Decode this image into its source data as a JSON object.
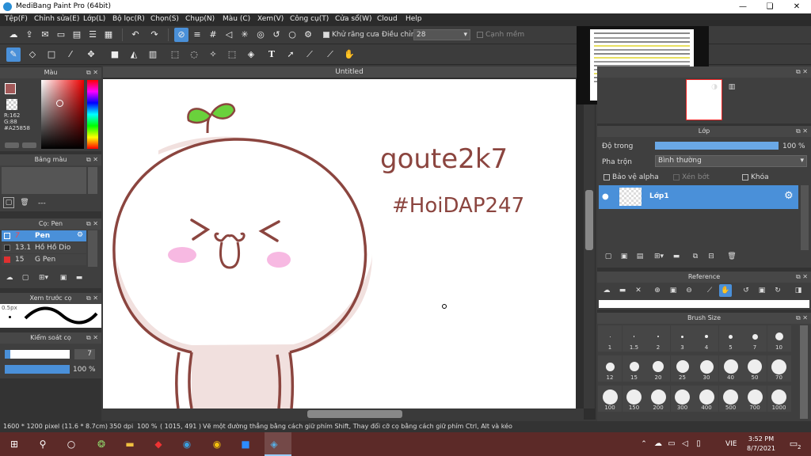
{
  "window": {
    "title": "MediBang Paint Pro (64bit)"
  },
  "menu": [
    "Tệp(F)",
    "Chỉnh sửa(E)",
    "Lớp(L)",
    "Bộ lọc(R)",
    "Chọn(S)",
    "Chụp(N)",
    "Màu (C)",
    "Xem(V)",
    "Công cụ(T)",
    "Cửa sổ(W)",
    "Cloud",
    "Help"
  ],
  "toolbar": {
    "antialias_label": "Khử răng cưa",
    "adjust_label": "Điều chỉnh",
    "adjust_value": "28",
    "edge_label": "Cạnh mềm"
  },
  "canvas": {
    "tab_title": "Untitled",
    "drawing_text_1": "goute2k7",
    "drawing_text_2": "#HoiDAP247"
  },
  "color_panel": {
    "title": "Màu",
    "r": "R:162",
    "g": "G:88",
    "b": "B:88",
    "hex": "#A25858",
    "primary": "#A25858"
  },
  "palette_panel": {
    "title": "Bảng màu",
    "dash": "---"
  },
  "brush_panel": {
    "title": "Cọ: Pen",
    "items": [
      {
        "size": "7",
        "name": "Pen",
        "selected": true,
        "color": "#A25858"
      },
      {
        "size": "13.1",
        "name": "Hồ Hồ Dio",
        "selected": false,
        "color": "#222222"
      },
      {
        "size": "15",
        "name": "G Pen",
        "selected": false,
        "color": "#e03030"
      }
    ]
  },
  "preview_panel": {
    "title": "Xem trước cọ",
    "size": "0.5px"
  },
  "control_panel": {
    "title": "Kiểm soát cọ",
    "size": "7",
    "opacity": "100 %",
    "opacity_frac": 1.0
  },
  "layer_panel": {
    "title": "Lớp",
    "opacity_label": "Độ trong",
    "opacity_value": "100 %",
    "opacity_frac": 1.0,
    "blend_label": "Pha trộn",
    "blend_value": "Bình thường",
    "protect_alpha": "Bảo vệ alpha",
    "clip": "Xén bớt",
    "lock": "Khóa",
    "layer_name": "Lớp1"
  },
  "reference_panel": {
    "title": "Reference"
  },
  "brushsize_panel": {
    "title": "Brush Size",
    "sizes": [
      "1",
      "1.5",
      "2",
      "3",
      "4",
      "5",
      "7",
      "10",
      "12",
      "15",
      "20",
      "25",
      "30",
      "40",
      "50",
      "70",
      "100",
      "150",
      "200",
      "300",
      "400",
      "500",
      "700",
      "1000"
    ]
  },
  "status": {
    "size": "1600 * 1200 pixel",
    "cm": "(11.6 * 8.7cm)",
    "dpi": "350 dpi",
    "zoom": "100 %",
    "coords": "( 1015, 491 )",
    "hint": "Vẽ một đường thẳng bằng cách giữ phím Shift, Thay đổi cỡ cọ bằng cách giữ phím Ctrl, Alt và kéo"
  },
  "taskbar": {
    "lang": "VIE",
    "time": "3:52 PM",
    "date": "8/7/2021",
    "notif": "2"
  }
}
